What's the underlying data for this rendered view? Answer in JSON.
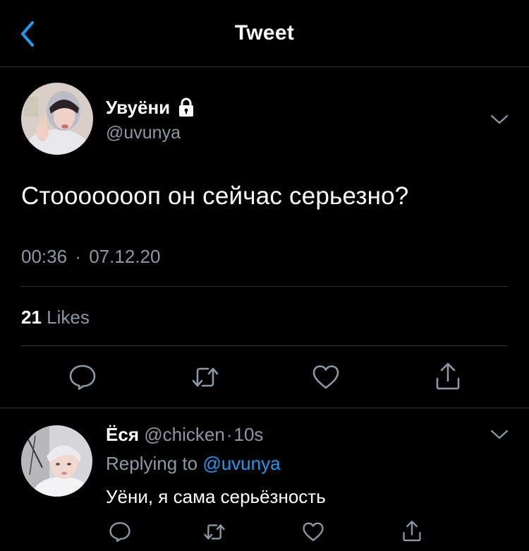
{
  "header": {
    "title": "Tweet"
  },
  "tweet": {
    "author_name": "Увуёни",
    "author_handle": "@uvunya",
    "text": "Стоооооооп он сейчас серьезно?",
    "time": "00:36",
    "separator": "·",
    "date": "07.12.20",
    "likes_count": "21",
    "likes_label": "Likes"
  },
  "reply": {
    "author_name": "Ёся",
    "author_handle": "@chicken",
    "separator": "·",
    "time_ago": "10s",
    "replying_label": "Replying to",
    "replying_handle": "@uvunya",
    "text": "Уёни, я сама серьёзность"
  },
  "icons": {
    "back": "chevron-left-icon",
    "lock": "lock-icon",
    "more": "chevron-down-icon",
    "reply": "reply-icon",
    "retweet": "retweet-icon",
    "like": "heart-icon",
    "share": "share-icon"
  },
  "colors": {
    "background": "#000000",
    "accent": "#1d9bf0",
    "secondary_text": "#8b98a5",
    "divider": "#2f3336"
  }
}
